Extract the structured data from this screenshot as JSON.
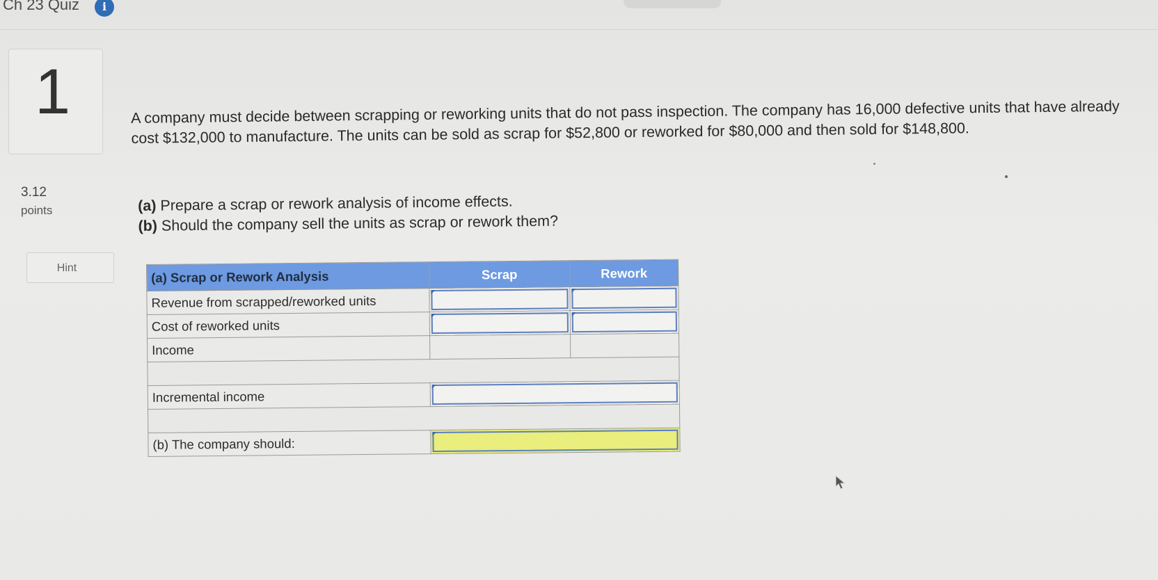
{
  "header": {
    "quiz_title": "Ch 23 Quiz",
    "info_badge": "i"
  },
  "question": {
    "number": "1",
    "points_value": "3.12",
    "points_label": "points",
    "hint_label": "Hint",
    "text": "A company must decide between scrapping or reworking units that do not pass inspection. The company has 16,000 defective units that have already cost $132,000 to manufacture. The units can be sold as scrap for $52,800 or reworked for $80,000 and then sold for $148,800.",
    "part_a_label": "(a)",
    "part_a_text": "Prepare a scrap or rework analysis of income effects.",
    "part_b_label": "(b)",
    "part_b_text": "Should the company sell the units as scrap or rework them?"
  },
  "analysis_table": {
    "header_label": "(a) Scrap or Rework Analysis",
    "col_scrap": "Scrap",
    "col_rework": "Rework",
    "rows": [
      {
        "label": "Revenue from scrapped/reworked units",
        "scrap": "",
        "rework": ""
      },
      {
        "label": "Cost of reworked units",
        "scrap": "",
        "rework": ""
      },
      {
        "label": "Income",
        "scrap": "",
        "rework": ""
      }
    ],
    "incremental_label": "Incremental income",
    "incremental_value": "",
    "company_should_label": "(b) The company should:",
    "company_should_value": ""
  },
  "colors": {
    "header_blue": "#6d9ae0",
    "input_border": "#5b7fbf",
    "answer_yellow": "#e9ee7c",
    "badge_blue": "#2f6db5"
  }
}
